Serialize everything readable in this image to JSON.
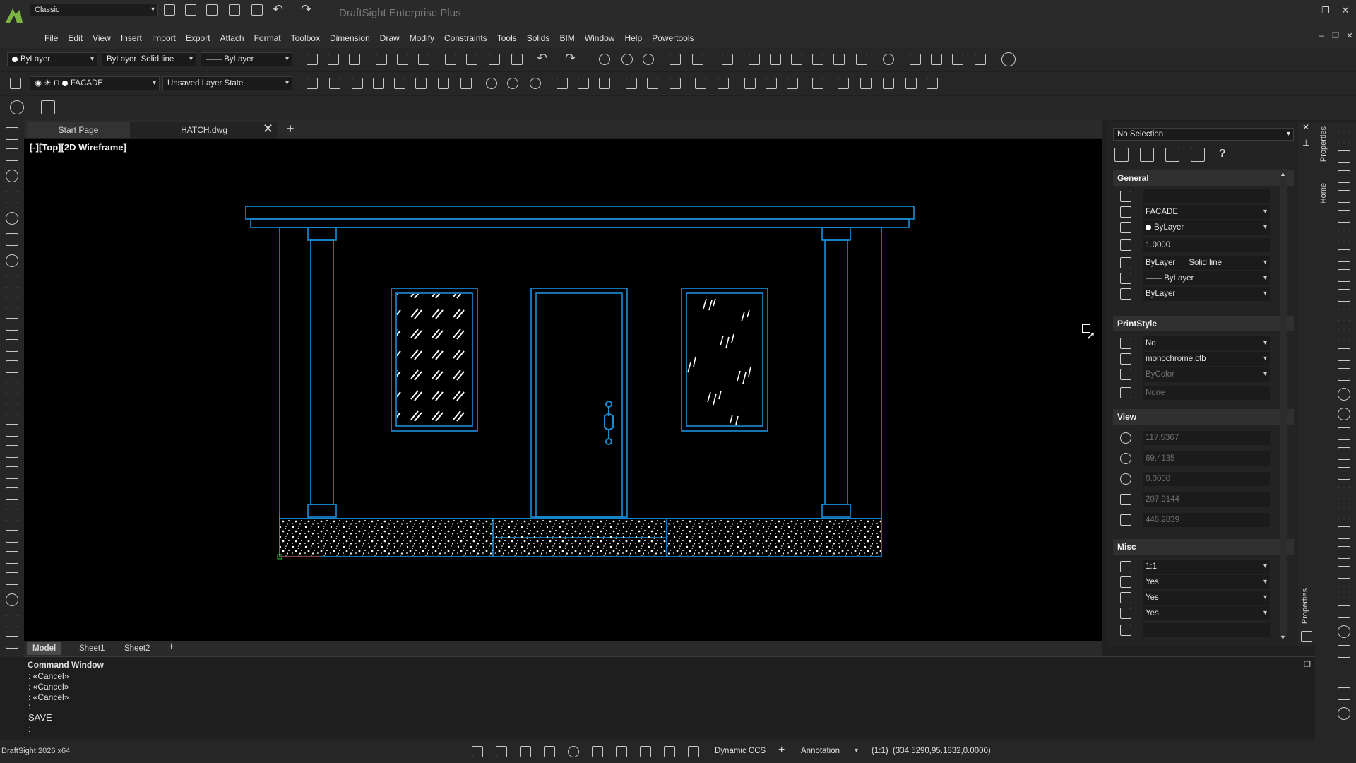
{
  "titlebar": {
    "workspace": "Classic",
    "title": "DraftSight Enterprise Plus"
  },
  "menu": [
    "File",
    "Edit",
    "View",
    "Insert",
    "Import",
    "Export",
    "Attach",
    "Format",
    "Toolbox",
    "Dimension",
    "Draw",
    "Modify",
    "Constraints",
    "Tools",
    "Solids",
    "BIM",
    "Window",
    "Help",
    "Powertools"
  ],
  "toolbar": {
    "color": "ByLayer",
    "linestyle_layer": "ByLayer",
    "linestyle": "Solid line",
    "lineweight": "—— ByLayer",
    "layer": "FACADE",
    "layer_state": "Unsaved Layer State"
  },
  "tabs": {
    "start": "Start Page",
    "drawing": "HATCH.dwg"
  },
  "viewport": {
    "label": "[-][Top][2D Wireframe]"
  },
  "layout_tabs": [
    "Model",
    "Sheet1",
    "Sheet2"
  ],
  "command": {
    "title": "Command Window",
    "lines": [
      ": «Cancel»",
      ": «Cancel»",
      ": «Cancel»",
      ":",
      "SAVE",
      ":"
    ]
  },
  "status": {
    "app": "DraftSight 2026 x64",
    "ccs": "Dynamic CCS",
    "annotation": "Annotation",
    "scale": "(1:1)",
    "coords": "(334.5290,95.1832,0.0000)"
  },
  "properties": {
    "selection": "No Selection",
    "panel_label": "Properties",
    "home_label": "Home",
    "sections": {
      "general": "General",
      "printstyle": "PrintStyle",
      "view": "View",
      "misc": "Misc"
    },
    "general": [
      "",
      "FACADE",
      "ByLayer",
      "1.0000",
      "ByLayer      Solid line",
      "—— ByLayer",
      "ByLayer"
    ],
    "printstyle": [
      "No",
      "monochrome.ctb",
      "ByColor",
      "None"
    ],
    "view": [
      "117.5367",
      "69.4135",
      "0.0000",
      "207.9144",
      "446.2839"
    ],
    "misc": [
      "1:1",
      "Yes",
      "Yes",
      "Yes",
      ""
    ]
  },
  "colors": {
    "drawing_stroke": "#1b8fd6",
    "background": "#000000",
    "ui": "#262626"
  }
}
